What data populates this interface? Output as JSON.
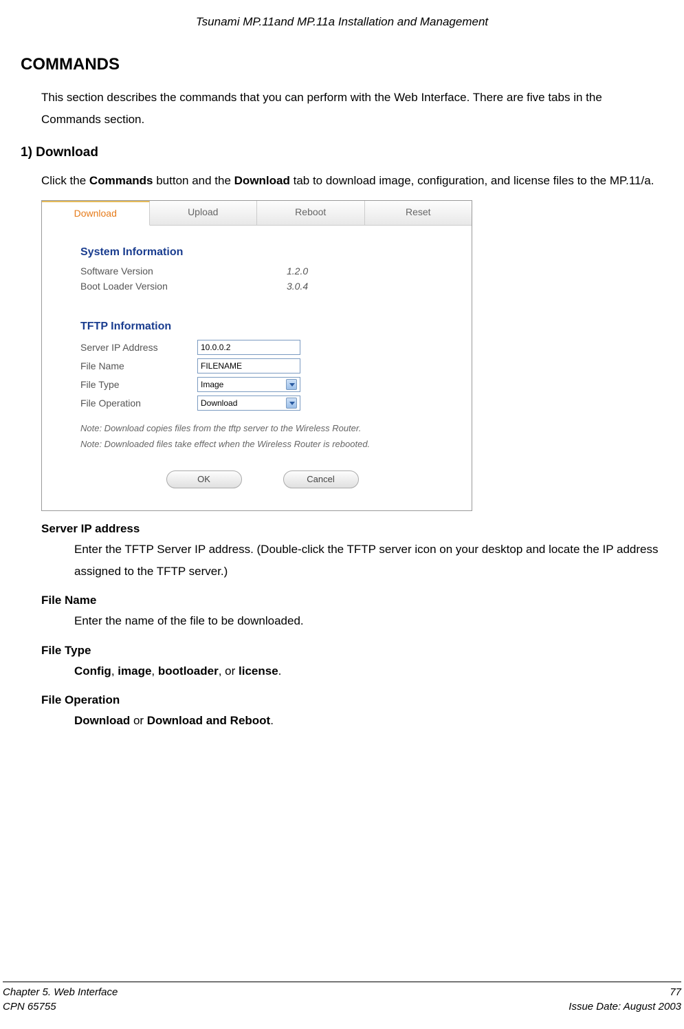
{
  "header": "Tsunami MP.11and MP.11a Installation and Management",
  "h1": "COMMANDS",
  "intro": "This section describes the commands that you can perform with the Web Interface.  There are five tabs in the Commands section.",
  "h2": "1) Download",
  "download_intro_pre": "Click the ",
  "download_intro_b1": "Commands",
  "download_intro_mid": " button and the ",
  "download_intro_b2": "Download",
  "download_intro_post": " tab to download image, configuration, and license files to the MP.11/a.",
  "tabs": {
    "t0": "Download",
    "t1": "Upload",
    "t2": "Reboot",
    "t3": "Reset"
  },
  "sysinfo": {
    "title": "System Information",
    "sw_label": "Software Version",
    "sw_value": "1.2.0",
    "bl_label": "Boot Loader Version",
    "bl_value": "3.0.4"
  },
  "tftp": {
    "title": "TFTP Information",
    "ip_label": "Server IP Address",
    "ip_value": "10.0.0.2",
    "file_label": "File Name",
    "file_value": "FILENAME",
    "type_label": "File Type",
    "type_value": "Image",
    "op_label": "File Operation",
    "op_value": "Download"
  },
  "note1": "Note: Download copies files from the tftp server to the Wireless Router.",
  "note2": "Note: Downloaded files take effect when the Wireless Router is rebooted.",
  "buttons": {
    "ok": "OK",
    "cancel": "Cancel"
  },
  "defs": {
    "ip_term": "Server IP address",
    "ip_body": "Enter the TFTP Server IP address.  (Double-click the TFTP server icon on your desktop and locate the IP address assigned to the TFTP server.)",
    "fn_term": "File Name",
    "fn_body": "Enter the name of the file to be downloaded.",
    "ft_term": "File Type",
    "ft_b1": "Config",
    "ft_s1": ", ",
    "ft_b2": "image",
    "ft_s2": ", ",
    "ft_b3": "bootloader",
    "ft_s3": ", or ",
    "ft_b4": "license",
    "ft_s4": ".",
    "fo_term": "File Operation",
    "fo_b1": "Download",
    "fo_s1": " or ",
    "fo_b2": "Download and Reboot",
    "fo_s2": "."
  },
  "footer": {
    "chapter": "Chapter 5.  Web Interface",
    "page": "77",
    "cpn": "CPN 65755",
    "issue": "Issue Date:  August 2003"
  }
}
